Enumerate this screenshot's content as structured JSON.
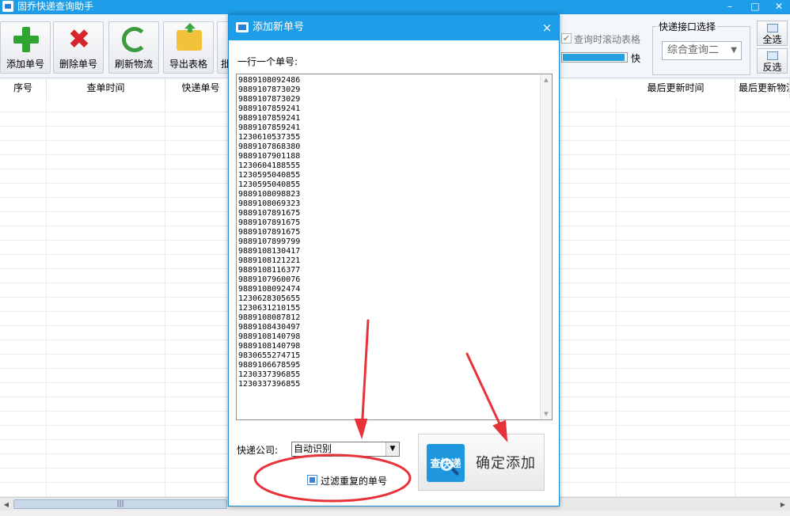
{
  "app": {
    "title": "固乔快递查询助手"
  },
  "window_controls": {
    "minimize": "–",
    "maximize": "□",
    "close": "✕"
  },
  "toolbar": {
    "buttons": [
      {
        "label": "添加单号",
        "icon": "plus-icon"
      },
      {
        "label": "删除单号",
        "icon": "delete-x-icon"
      },
      {
        "label": "刷新物流",
        "icon": "refresh-icon"
      },
      {
        "label": "导出表格",
        "icon": "folder-export-icon"
      },
      {
        "label": "批"
      }
    ],
    "scroll_check_label": "查询时滚动表格",
    "scroll_checked": true,
    "progress_label": "快",
    "progress_value": 0.98,
    "api_group_title": "快递接口选择",
    "api_select_value": "综合查询二",
    "select_all": "全选",
    "invert_select": "反选"
  },
  "grid": {
    "columns": [
      "序号",
      "查单时间",
      "快递单号",
      "最后更新时间",
      "最后更新物流"
    ]
  },
  "dialog": {
    "title": "添加新单号",
    "close": "×",
    "prompt": "一行一个单号:",
    "numbers": [
      "9889108092486",
      "9889107873029",
      "9889107873029",
      "9889107859241",
      "9889107859241",
      "9889107859241",
      "1230610537355",
      "9889107868380",
      "9889107901188",
      "1230604188555",
      "1230595040855",
      "1230595040855",
      "9889108098823",
      "9889108069323",
      "9889107891675",
      "9889107891675",
      "9889107891675",
      "9889107899799",
      "9889108130417",
      "9889108121221",
      "9889108116377",
      "9889107960076",
      "9889108092474",
      "1230628305655",
      "1230631210155",
      "9889108087812",
      "9889108430497",
      "9889108140798",
      "9889108140798",
      "9830655274715",
      "9889106678595",
      "1230337396855",
      "1230337396855"
    ],
    "courier_label": "快递公司:",
    "courier_value": "自动识别",
    "filter_label": "过滤重复的单号",
    "filter_checked": true,
    "confirm_logo_text": "查快递",
    "confirm_label": "确定添加"
  },
  "colors": {
    "title_blue": "#1e9ee8",
    "annotation_red": "#e8323a"
  }
}
